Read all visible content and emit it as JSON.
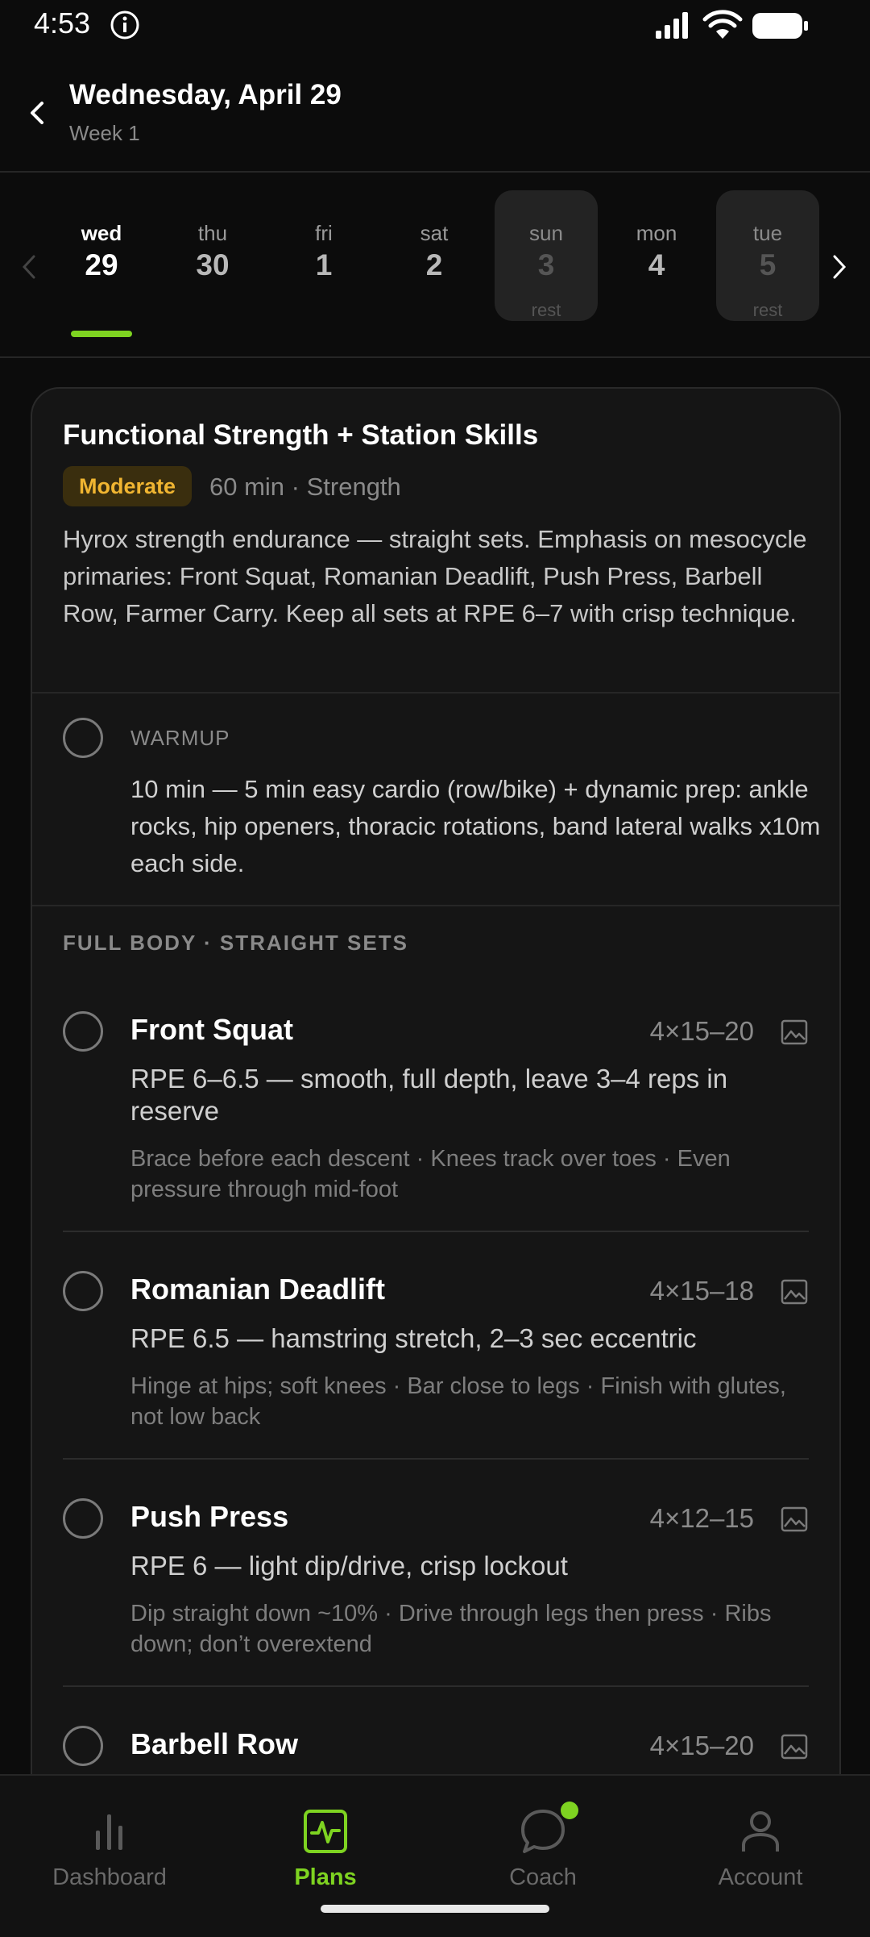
{
  "status_bar": {
    "time": "4:53"
  },
  "header": {
    "title": "Wednesday, April 29",
    "subtitle": "Week 1"
  },
  "week": {
    "days": [
      {
        "name": "wed",
        "num": "29",
        "selected": true
      },
      {
        "name": "thu",
        "num": "30"
      },
      {
        "name": "fri",
        "num": "1"
      },
      {
        "name": "sat",
        "num": "2"
      },
      {
        "name": "sun",
        "num": "3",
        "rest": "rest"
      },
      {
        "name": "mon",
        "num": "4"
      },
      {
        "name": "tue",
        "num": "5",
        "rest": "rest"
      }
    ]
  },
  "workout": {
    "title": "Functional Strength + Station Skills",
    "intensity": "Moderate",
    "meta": "60 min · Strength",
    "description": "Hyrox strength endurance — straight sets. Emphasis on mesocycle primaries: Front Squat, Romanian Deadlift, Push Press, Barbell Row, Farmer Carry. Keep all sets at RPE 6–7 with crisp technique."
  },
  "warmup": {
    "label": "WARMUP",
    "text": "10 min — 5 min easy cardio (row/bike) + dynamic prep: ankle rocks, hip openers, thoracic rotations, band lateral walks x10m each side."
  },
  "section_title": "FULL BODY · STRAIGHT SETS",
  "exercises": [
    {
      "name": "Front Squat",
      "reps": "4×15–20",
      "rpe": "RPE 6–6.5 — smooth, full depth, leave 3–4 reps in reserve",
      "cues": "Brace before each descent · Knees track over toes · Even pressure through mid-foot"
    },
    {
      "name": "Romanian Deadlift",
      "reps": "4×15–18",
      "rpe": "RPE 6.5 — hamstring stretch, 2–3 sec eccentric",
      "cues": "Hinge at hips; soft knees · Bar close to legs · Finish with glutes, not low back"
    },
    {
      "name": "Push Press",
      "reps": "4×12–15",
      "rpe": "RPE 6 — light dip/drive, crisp lockout",
      "cues": "Dip straight down ~10% · Drive through legs then press · Ribs down; don’t overextend"
    },
    {
      "name": "Barbell Row",
      "reps": "4×15–20"
    }
  ],
  "nav": {
    "dashboard": "Dashboard",
    "plans": "Plans",
    "coach": "Coach",
    "account": "Account"
  },
  "colors": {
    "accent": "#7ed321",
    "badge_text": "#f0b531",
    "badge_bg": "#3a2e0e"
  }
}
